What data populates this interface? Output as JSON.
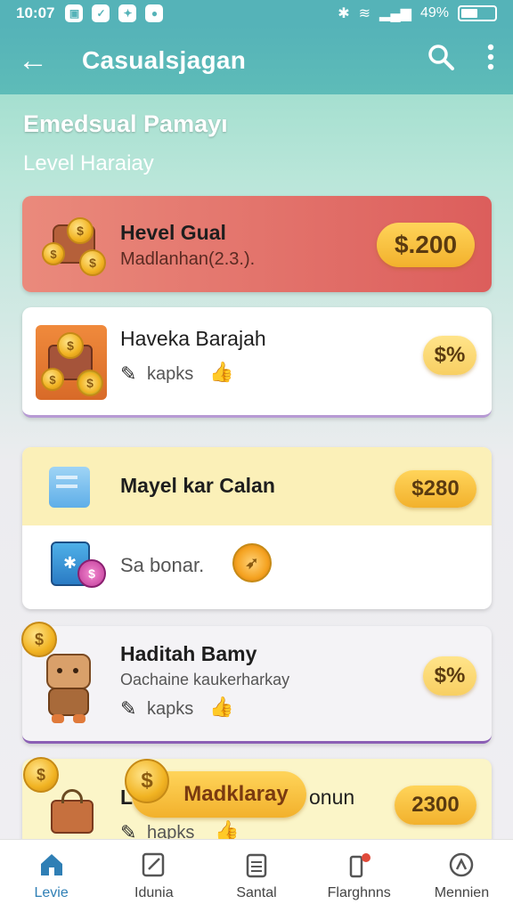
{
  "status_bar": {
    "time": "10:07",
    "battery": "49%"
  },
  "app_bar": {
    "title": "Casualsjagan"
  },
  "header": {
    "heading": "Emedsual Pamayı",
    "subheading": "Level Haraiay"
  },
  "cards": [
    {
      "title": "Hevel Gual",
      "subtitle": "Madlanhan(2.3.).",
      "badge": "$.200"
    },
    {
      "title": "Haveka Barajah",
      "subtitle": "kapks",
      "badge": "$%"
    },
    {
      "title": "Mayel kar Calan",
      "badge": "$280",
      "subtitle": "Sa bonar."
    },
    {
      "title": "Haditah Bamy",
      "subtitle": "Oachaine kaukerharkay",
      "meta": "kapks",
      "badge": "$%"
    },
    {
      "title": "L",
      "title_tail": "onun",
      "banner": "Madklaray",
      "subtitle": "hapks",
      "badge": "2300"
    }
  ],
  "bottom_nav": [
    {
      "label": "Levie"
    },
    {
      "label": "Idunia"
    },
    {
      "label": "Santal"
    },
    {
      "label": "Flarghnns"
    },
    {
      "label": "Mennien"
    }
  ],
  "colors": {
    "app_bar": "#55b3b8",
    "card_highlight": "#e1686a",
    "badge_gold": "#f6c13a",
    "card_cream": "#fbf0b8",
    "nav_active": "#2f7fb5"
  }
}
